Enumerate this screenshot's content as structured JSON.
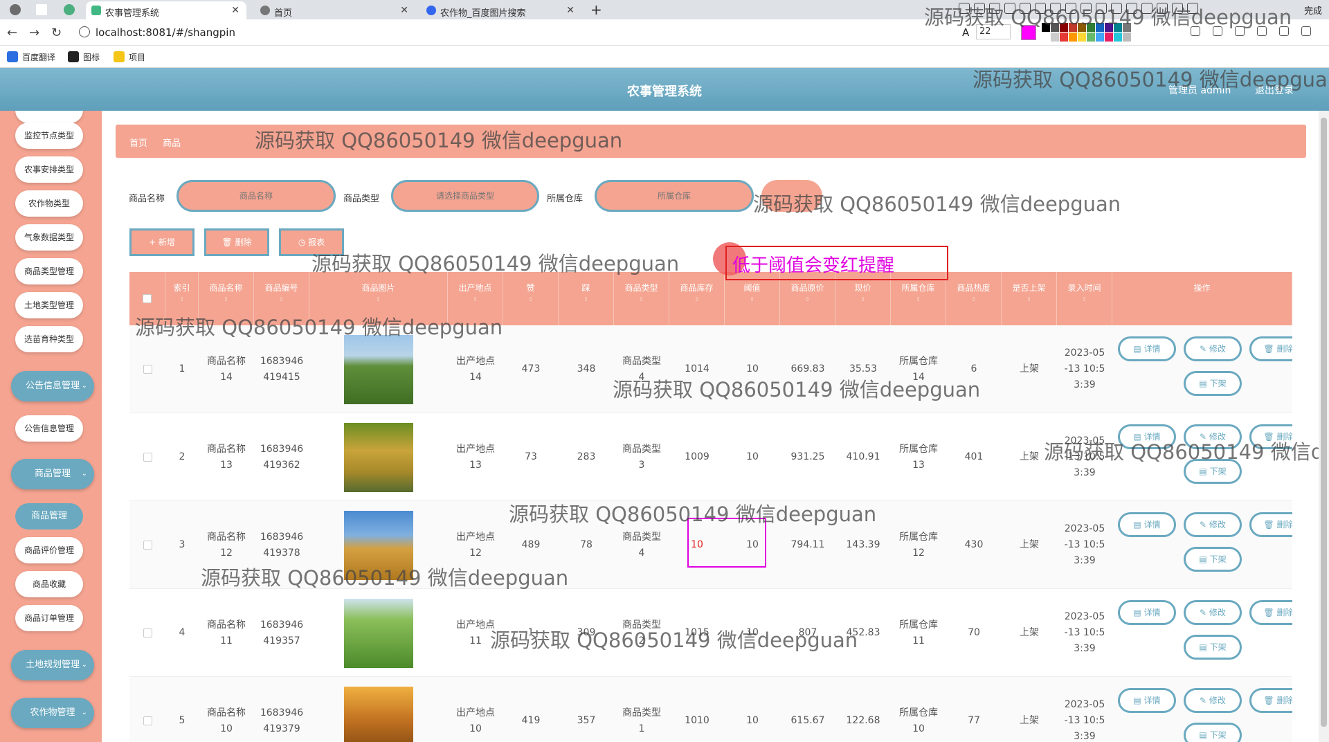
{
  "browser": {
    "tabs": [
      {
        "label": "农事管理系统",
        "active": true
      },
      {
        "label": "首页",
        "active": false
      },
      {
        "label": "农作物_百度图片搜索",
        "active": false
      }
    ],
    "url": "localhost:8081/#/shangpin",
    "font_size": "22",
    "finish_label": "完成",
    "bookmarks": [
      "百度翻译",
      "图标",
      "项目"
    ]
  },
  "header": {
    "title": "农事管理系统",
    "admin": "管理员 admin",
    "logout": "退出登录"
  },
  "sidebar": {
    "items": [
      "监控节点类型",
      "农事安排类型",
      "农作物类型",
      "气象数据类型",
      "商品类型管理",
      "土地类型管理",
      "选苗育种类型",
      "公告信息管理"
    ],
    "groups": [
      "公告信息管理",
      "商品管理",
      "土地规划管理",
      "农作物管理"
    ],
    "goods_items": [
      "商品管理",
      "商品评价管理",
      "商品收藏",
      "商品订单管理"
    ]
  },
  "breadcrumb": [
    "首页",
    "商品"
  ],
  "search": {
    "name_label": "商品名称",
    "name_placeholder": "商品名称",
    "type_label": "商品类型",
    "type_placeholder": "请选择商品类型",
    "warehouse_label": "所属仓库",
    "warehouse_placeholder": "所属仓库"
  },
  "actions": {
    "add": "+ 新增",
    "delete": "🗑 删除",
    "report": "◷ 报表"
  },
  "annotation": "低于阈值会变红提醒",
  "watermark": "源码获取 QQ86050149 微信deepguan",
  "table": {
    "headers": [
      "索引",
      "商品名称",
      "商品编号",
      "商品图片",
      "出产地点",
      "赞",
      "踩",
      "商品类型",
      "商品库存",
      "阈值",
      "商品原价",
      "现价",
      "所属仓库",
      "商品热度",
      "是否上架",
      "录入时间",
      "操作"
    ],
    "rows": [
      {
        "idx": "1",
        "name": "商品名称\n14",
        "code": "1683946\n419415",
        "place": "出产地点\n14",
        "zan": "473",
        "cai": "348",
        "type": "商品类型\n4",
        "stock": "1014",
        "threshold": "10",
        "orig": "669.83",
        "now": "35.53",
        "warehouse": "所属仓库\n14",
        "hot": "6",
        "status": "上架",
        "time": "2023-05\n-13 10:5\n3:39"
      },
      {
        "idx": "2",
        "name": "商品名称\n13",
        "code": "1683946\n419362",
        "place": "出产地点\n13",
        "zan": "73",
        "cai": "283",
        "type": "商品类型\n3",
        "stock": "1009",
        "threshold": "10",
        "orig": "931.25",
        "now": "410.91",
        "warehouse": "所属仓库\n13",
        "hot": "401",
        "status": "上架",
        "time": "2023-05\n-13 10:5\n3:39"
      },
      {
        "idx": "3",
        "name": "商品名称\n12",
        "code": "1683946\n419378",
        "place": "出产地点\n12",
        "zan": "489",
        "cai": "78",
        "type": "商品类型\n4",
        "stock": "10",
        "threshold": "10",
        "orig": "794.11",
        "now": "143.39",
        "warehouse": "所属仓库\n12",
        "hot": "430",
        "status": "上架",
        "time": "2023-05\n-13 10:5\n3:39"
      },
      {
        "idx": "4",
        "name": "商品名称\n11",
        "code": "1683946\n419357",
        "place": "出产地点\n11",
        "zan": "1",
        "cai": "309",
        "type": "商品类型\n2",
        "stock": "1015",
        "threshold": "10",
        "orig": "807",
        "now": "452.83",
        "warehouse": "所属仓库\n11",
        "hot": "70",
        "status": "上架",
        "time": "2023-05\n-13 10:5\n3:39"
      },
      {
        "idx": "5",
        "name": "商品名称\n10",
        "code": "1683946\n419379",
        "place": "出产地点\n10",
        "zan": "419",
        "cai": "357",
        "type": "商品类型\n1",
        "stock": "1010",
        "threshold": "10",
        "orig": "615.67",
        "now": "122.68",
        "warehouse": "所属仓库\n10",
        "hot": "77",
        "status": "上架",
        "time": "2023-05\n-13 10:5\n3:39"
      }
    ],
    "ops": {
      "detail": "详情",
      "edit": "修改",
      "delete": "删除",
      "off": "下架"
    }
  },
  "colors": {
    "accent": "#f4a491",
    "blue": "#6aa9c0",
    "alert": "#e02020"
  }
}
